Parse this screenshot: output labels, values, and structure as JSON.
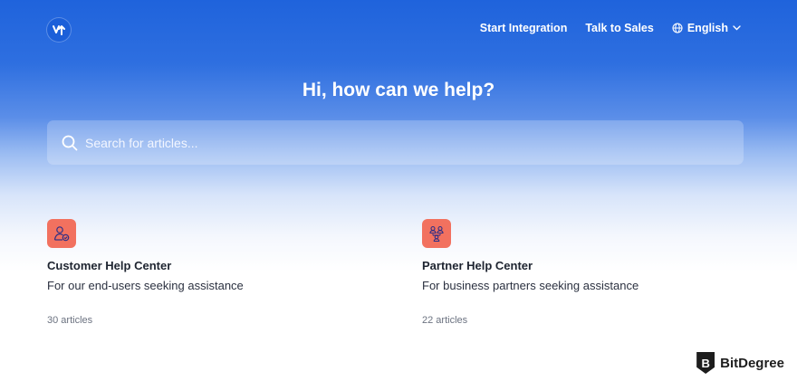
{
  "header": {
    "nav": {
      "start_integration": "Start Integration",
      "talk_to_sales": "Talk to Sales",
      "language": "English"
    }
  },
  "hero": {
    "title": "Hi, how can we help?"
  },
  "search": {
    "placeholder": "Search for articles..."
  },
  "collections": [
    {
      "title": "Customer Help Center",
      "description": "For our end-users seeking assistance",
      "count": "30 articles",
      "icon": "customer-support-icon"
    },
    {
      "title": "Partner Help Center",
      "description": "For business partners seeking assistance",
      "count": "22 articles",
      "icon": "partners-icon"
    }
  ],
  "watermark": {
    "text": "BitDegree"
  },
  "colors": {
    "brand_blue": "#1f63dc",
    "card_icon_bg": "#f2715f",
    "card_icon_stroke": "#2f2f86"
  }
}
